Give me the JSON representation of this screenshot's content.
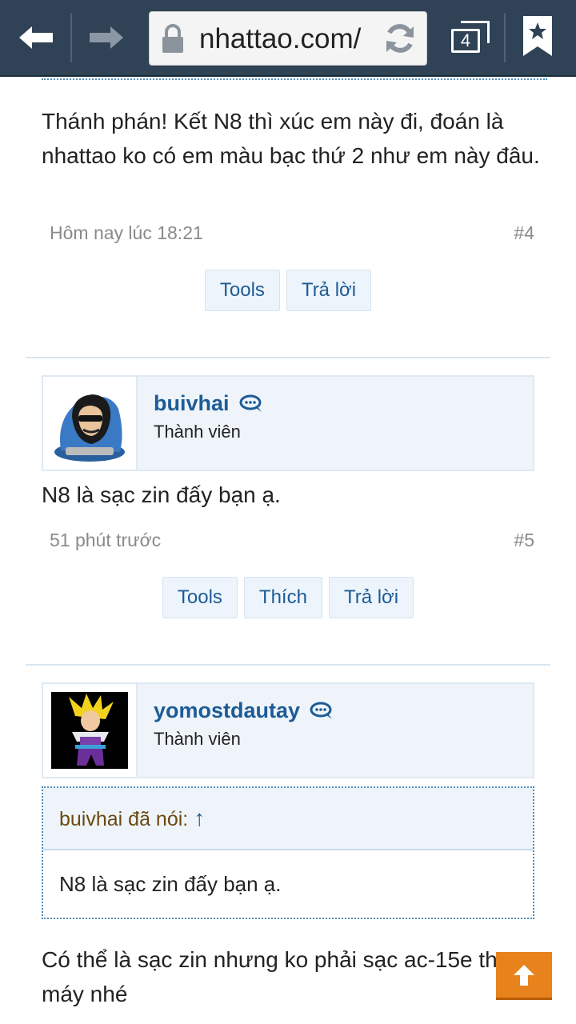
{
  "browser": {
    "url": "nhattao.com/",
    "tab_count": "4"
  },
  "posts": [
    {
      "text": "Thánh phán! Kết N8 thì xúc em này đi, đoán là nhattao ko có em màu bạc thứ 2 như em này đâu.",
      "time": "Hôm nay lúc 18:21",
      "number": "#4",
      "actions": [
        "Tools",
        "Trả lời"
      ]
    },
    {
      "username": "buivhai",
      "user_title": "Thành viên",
      "text": "N8 là sạc zin đấy bạn ạ.",
      "time": "51 phút trước",
      "number": "#5",
      "actions": [
        "Tools",
        "Thích",
        "Trả lời"
      ]
    },
    {
      "username": "yomostdautay",
      "user_title": "Thành viên",
      "quote": {
        "author": "buivhai đã nói:",
        "arrow": "↑",
        "text": "N8 là sạc zin đấy bạn ạ."
      },
      "text": "Có thể là sạc zin nhưng ko phải sạc ac-15e theo máy nhé"
    }
  ],
  "colors": {
    "toolbar": "#2f4256",
    "link": "#1d5b96",
    "scroll_top": "#e8821c"
  }
}
